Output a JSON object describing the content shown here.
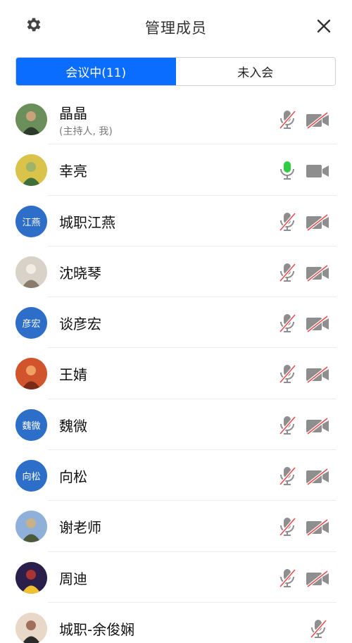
{
  "header": {
    "title": "管理成员",
    "settings_icon": "gear-icon",
    "close_icon": "close-icon"
  },
  "tabs": [
    {
      "label": "会议中(11)",
      "active": true
    },
    {
      "label": "未入会",
      "active": false
    }
  ],
  "colors": {
    "accent": "#0a6dff",
    "avatar_text_bg": "#2d6ec8",
    "icon_gray": "#8e8e8e",
    "mute_slash_red": "#e64a4a",
    "mic_active_green": "#2ecc40"
  },
  "members": [
    {
      "name": "晶晶",
      "subtitle": "(主持人, 我)",
      "avatar_type": "photo",
      "mic": "muted",
      "camera": "off"
    },
    {
      "name": "幸亮",
      "subtitle": "",
      "avatar_type": "photo",
      "mic": "speaking",
      "camera": "on"
    },
    {
      "name": "城职江燕",
      "subtitle": "",
      "avatar_type": "text",
      "avatar_text": "江燕",
      "mic": "muted",
      "camera": "off"
    },
    {
      "name": "沈晓琴",
      "subtitle": "",
      "avatar_type": "photo",
      "mic": "muted",
      "camera": "off"
    },
    {
      "name": "谈彦宏",
      "subtitle": "",
      "avatar_type": "text",
      "avatar_text": "彦宏",
      "mic": "muted",
      "camera": "off"
    },
    {
      "name": "王婧",
      "subtitle": "",
      "avatar_type": "photo",
      "mic": "muted",
      "camera": "off"
    },
    {
      "name": "魏微",
      "subtitle": "",
      "avatar_type": "text",
      "avatar_text": "魏微",
      "mic": "muted",
      "camera": "off"
    },
    {
      "name": "向松",
      "subtitle": "",
      "avatar_type": "text",
      "avatar_text": "向松",
      "mic": "muted",
      "camera": "off"
    },
    {
      "name": "谢老师",
      "subtitle": "",
      "avatar_type": "photo",
      "mic": "muted",
      "camera": "off"
    },
    {
      "name": "周迪",
      "subtitle": "",
      "avatar_type": "photo",
      "mic": "muted",
      "camera": "off"
    },
    {
      "name": "城职-余俊娴",
      "subtitle": "",
      "avatar_type": "photo",
      "mic": "muted",
      "camera": "none"
    }
  ]
}
